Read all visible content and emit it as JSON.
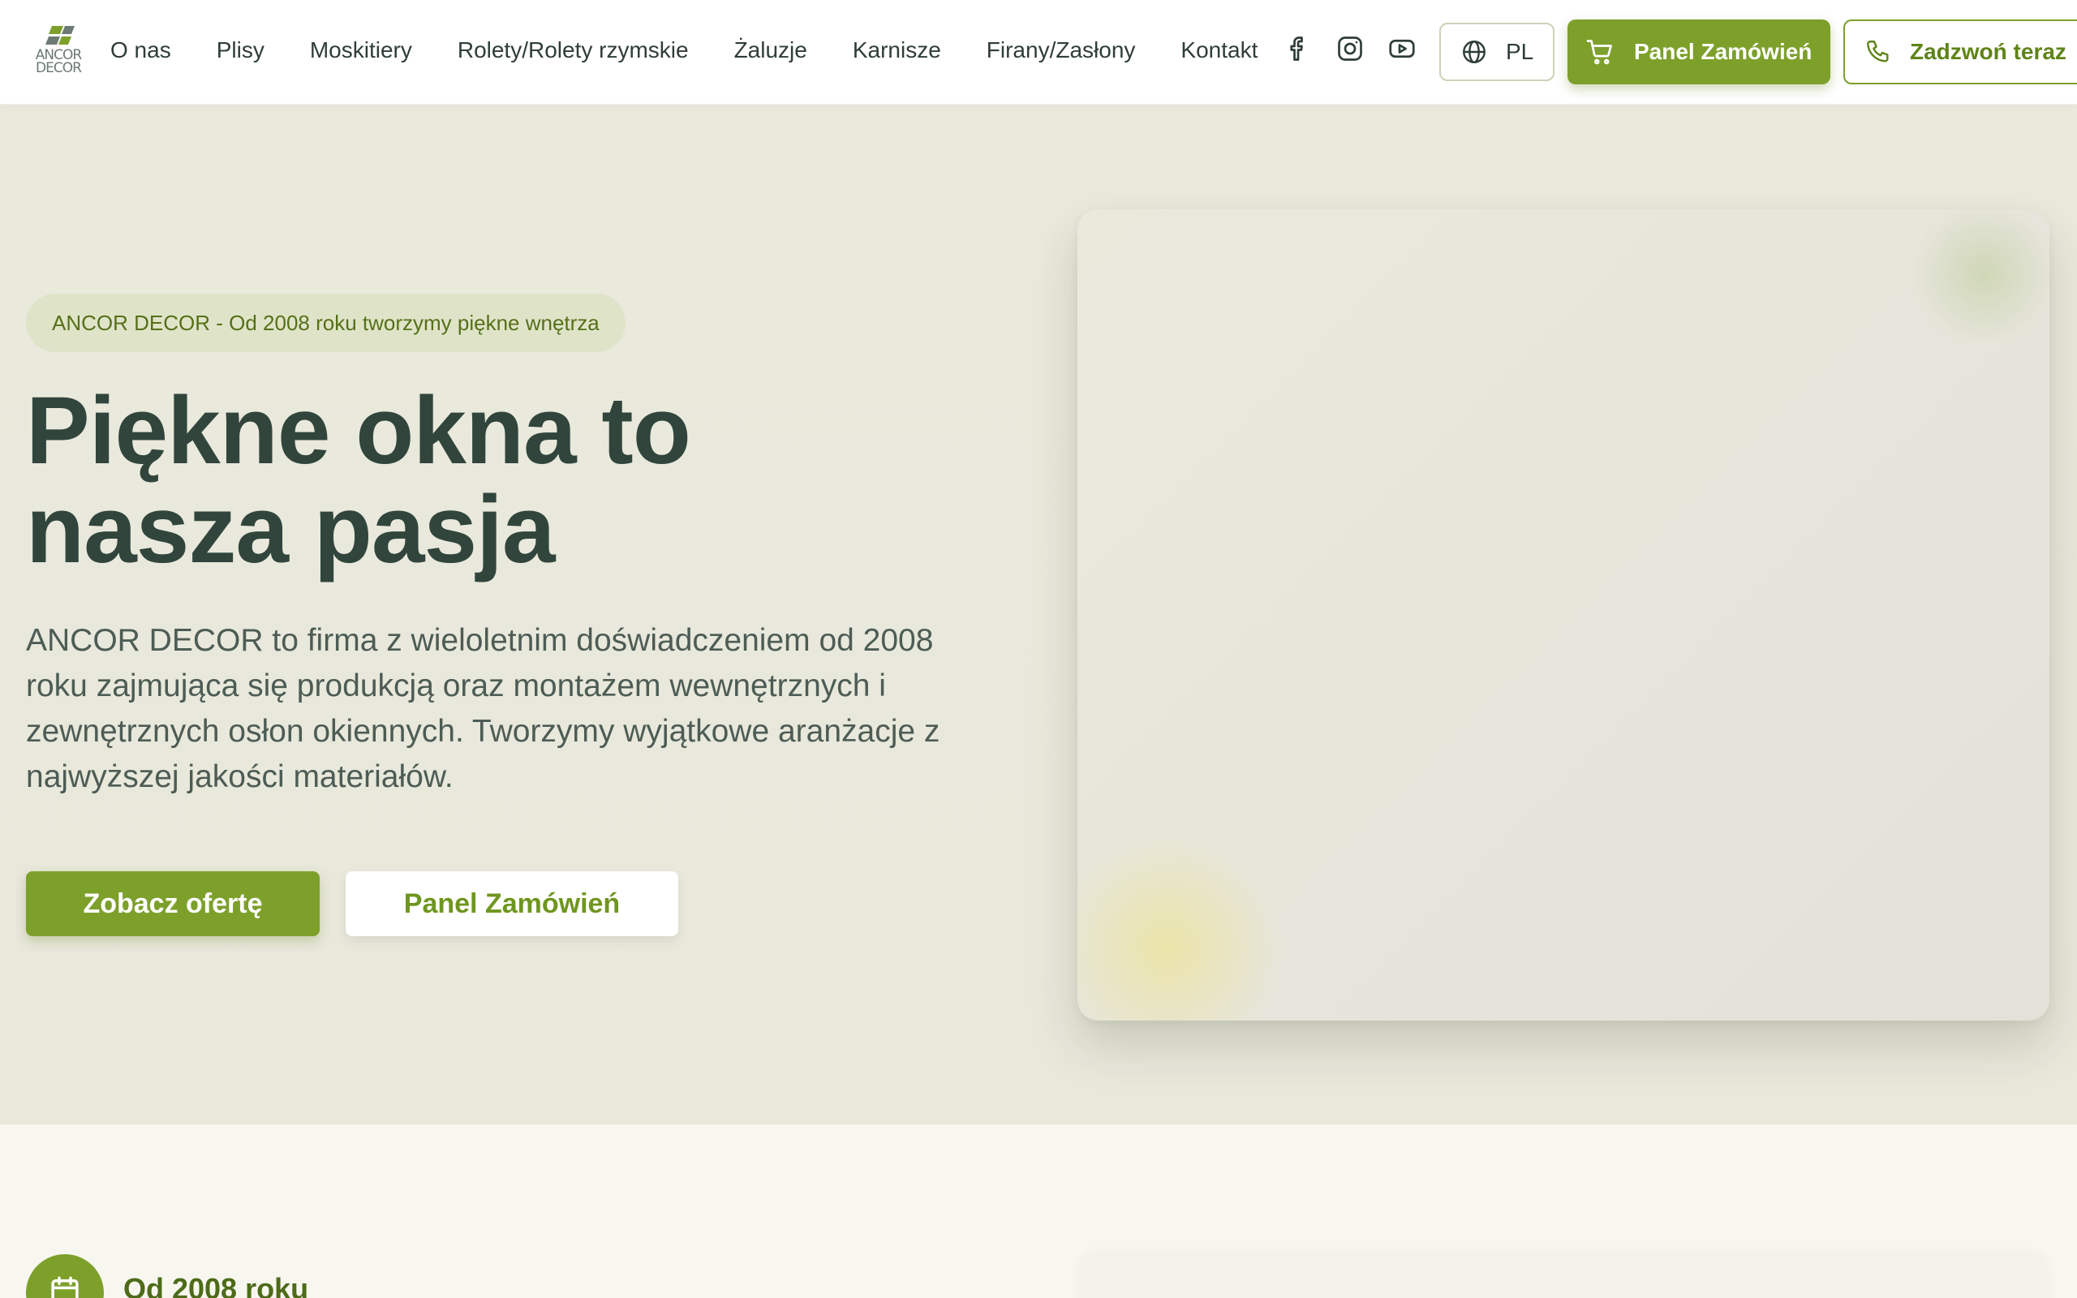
{
  "brand": {
    "logo_line1": "ANCOR",
    "logo_line2": "DECOR",
    "accent_color": "#7da02b",
    "heading_color": "#31453c"
  },
  "nav": {
    "items": [
      "O nas",
      "Plisy",
      "Moskitiery",
      "Rolety/Rolety rzymskie",
      "Żaluzje",
      "Karnisze",
      "Firany/Zasłony",
      "Kontakt"
    ]
  },
  "socials": [
    "facebook-icon",
    "instagram-icon",
    "youtube-icon"
  ],
  "header": {
    "lang_label": "PL",
    "lang_icon": "globe-icon",
    "panel_label": "Panel Zamówień",
    "panel_icon": "cart-icon",
    "call_label": "Zadzwoń teraz",
    "call_icon": "phone-icon"
  },
  "hero": {
    "badge": "ANCOR DECOR - Od 2008 roku tworzymy piękne wnętrza",
    "title_line1": "Piękne okna to",
    "title_line2": "nasza pasja",
    "description": "ANCOR DECOR to firma z wieloletnim doświadczeniem od 2008 roku zajmująca się produkcją oraz montażem wewnętrznych i zewnętrznych osłon okiennych. Tworzymy wyjątkowe aranżacje z najwyższej jakości materiałów.",
    "cta_primary": "Zobacz ofertę",
    "cta_secondary": "Panel Zamówień"
  },
  "features": {
    "first_title": "Od 2008 roku",
    "first_icon": "calendar-icon"
  }
}
